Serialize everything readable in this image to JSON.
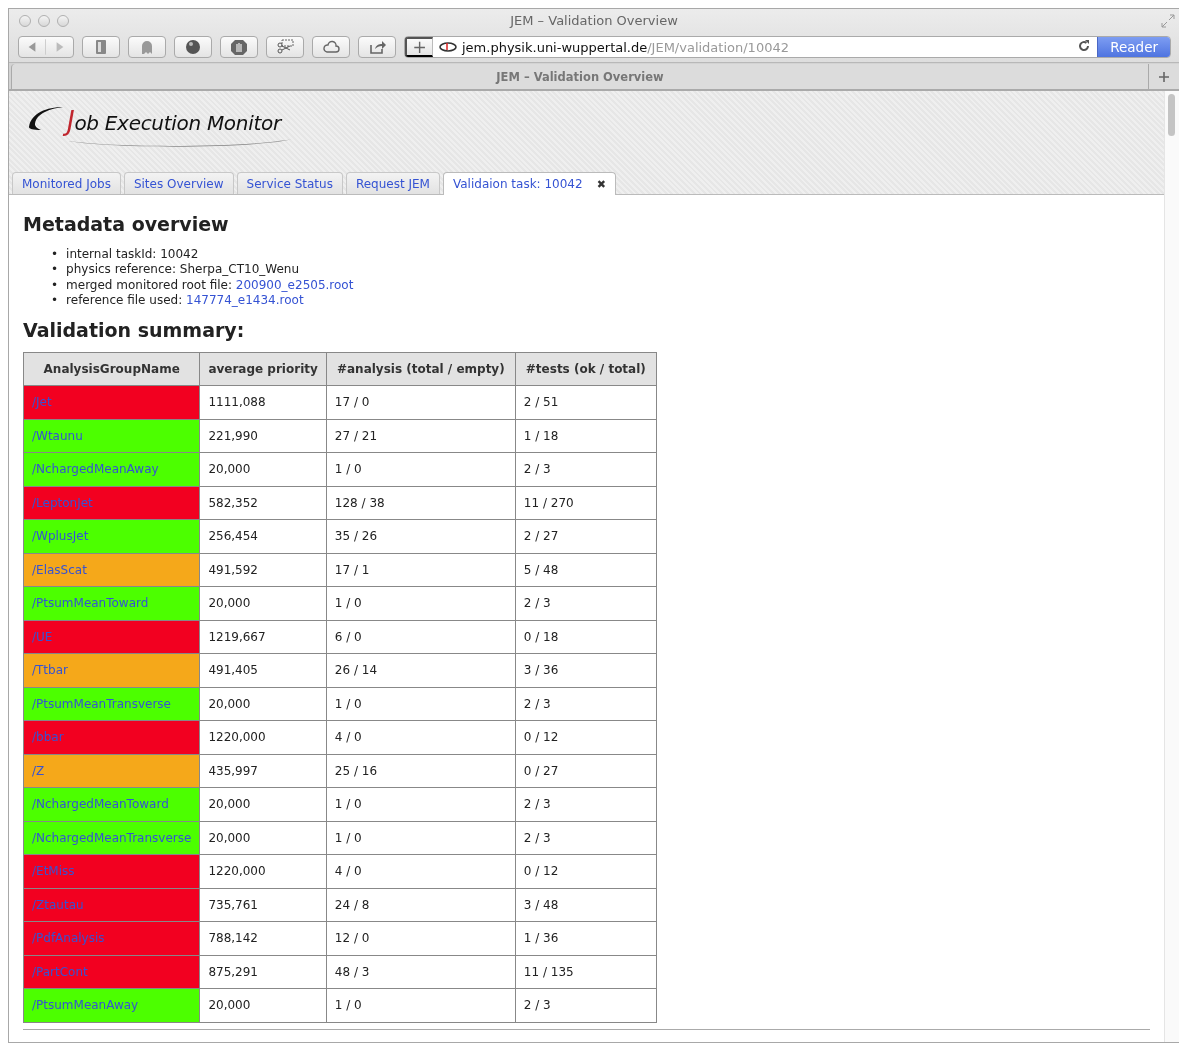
{
  "window": {
    "title": "JEM – Validation Overview"
  },
  "toolbar": {
    "address": {
      "host": "jem.physik.uni-wuppertal.de",
      "path": "/JEM/validation/10042"
    },
    "reader_button": "Reader",
    "new_tab_button": "+"
  },
  "browser_tabs": [
    {
      "label": "JEM – Validation Overview",
      "selected": true
    }
  ],
  "site": {
    "logo": "Job Execution Monitor",
    "tabs": [
      {
        "label": "Monitored Jobs",
        "selected": false
      },
      {
        "label": "Sites Overview",
        "selected": false
      },
      {
        "label": "Service Status",
        "selected": false
      },
      {
        "label": "Request JEM",
        "selected": false
      },
      {
        "label": "Validaion task: 10042",
        "selected": true,
        "close": "✖"
      }
    ]
  },
  "metadata": {
    "heading": "Metadata overview",
    "items": [
      {
        "kind": "text",
        "bullet": "•",
        "label": "internal taskId:",
        "value": "10042"
      },
      {
        "kind": "text",
        "bullet": "•",
        "label": "physics reference:",
        "value": "Sherpa_CT10_Wenu"
      },
      {
        "kind": "link",
        "bullet": "•",
        "label": "merged monitored root file:",
        "value": "200900_e2505.root"
      },
      {
        "kind": "link",
        "bullet": "•",
        "label": "reference file used:",
        "value": "147774_e1434.root"
      }
    ]
  },
  "summary": {
    "heading": "Validation summary:",
    "columns": [
      "AnalysisGroupName",
      "average priority",
      "#analysis (total / empty)",
      "#tests (ok / total)"
    ],
    "rows": [
      {
        "color": "#f20020",
        "cells": [
          "/Jet",
          "1111,088",
          "17 / 0",
          "2 / 51"
        ]
      },
      {
        "color": "#4cff00",
        "cells": [
          "/Wtaunu",
          "221,990",
          "27 / 21",
          "1 / 18"
        ]
      },
      {
        "color": "#4cff00",
        "cells": [
          "/NchargedMeanAway",
          "20,000",
          "1 / 0",
          "2 / 3"
        ]
      },
      {
        "color": "#f20020",
        "cells": [
          "/LeptonJet",
          "582,352",
          "128 / 38",
          "11 / 270"
        ]
      },
      {
        "color": "#4cff00",
        "cells": [
          "/WplusJet",
          "256,454",
          "35 / 26",
          "2 / 27"
        ]
      },
      {
        "color": "#f5a81a",
        "cells": [
          "/ElasScat",
          "491,592",
          "17 / 1",
          "5 / 48"
        ]
      },
      {
        "color": "#4cff00",
        "cells": [
          "/PtsumMeanToward",
          "20,000",
          "1 / 0",
          "2 / 3"
        ]
      },
      {
        "color": "#f20020",
        "cells": [
          "/UE",
          "1219,667",
          "6 / 0",
          "0 / 18"
        ]
      },
      {
        "color": "#f5a81a",
        "cells": [
          "/Ttbar",
          "491,405",
          "26 / 14",
          "3 / 36"
        ]
      },
      {
        "color": "#4cff00",
        "cells": [
          "/PtsumMeanTransverse",
          "20,000",
          "1 / 0",
          "2 / 3"
        ]
      },
      {
        "color": "#f20020",
        "cells": [
          "/bbar",
          "1220,000",
          "4 / 0",
          "0 / 12"
        ]
      },
      {
        "color": "#f5a81a",
        "cells": [
          "/Z",
          "435,997",
          "25 / 16",
          "0 / 27"
        ]
      },
      {
        "color": "#4cff00",
        "cells": [
          "/NchargedMeanToward",
          "20,000",
          "1 / 0",
          "2 / 3"
        ]
      },
      {
        "color": "#4cff00",
        "cells": [
          "/NchargedMeanTransverse",
          "20,000",
          "1 / 0",
          "2 / 3"
        ]
      },
      {
        "color": "#f20020",
        "cells": [
          "/EtMiss",
          "1220,000",
          "4 / 0",
          "0 / 12"
        ]
      },
      {
        "color": "#f20020",
        "cells": [
          "/Ztautau",
          "735,761",
          "24 / 8",
          "3 / 48"
        ]
      },
      {
        "color": "#f20020",
        "cells": [
          "/PdfAnalysis",
          "788,142",
          "12 / 0",
          "1 / 36"
        ]
      },
      {
        "color": "#f20020",
        "cells": [
          "/PartCont",
          "875,291",
          "48 / 3",
          "11 / 135"
        ]
      },
      {
        "color": "#4cff00",
        "cells": [
          "/PtsumMeanAway",
          "20,000",
          "1 / 0",
          "2 / 3"
        ]
      }
    ]
  }
}
